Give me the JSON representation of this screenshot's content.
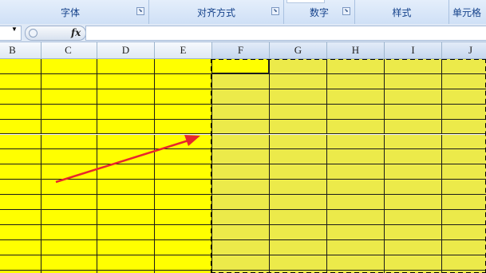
{
  "ribbon": {
    "groups": [
      {
        "label": "字体",
        "launcher": "⬊"
      },
      {
        "label": "对齐方式",
        "launcher": "⬊"
      },
      {
        "label": "数字",
        "launcher": "⬊"
      },
      {
        "label": "样式"
      },
      {
        "label": "单元格"
      }
    ]
  },
  "formula_bar": {
    "name_box_value": "",
    "name_box_arrow": "▼",
    "fx_label": "fx",
    "content": ""
  },
  "columns": [
    "B",
    "C",
    "D",
    "E",
    "F",
    "G",
    "H",
    "I",
    "J"
  ],
  "selected_columns": [
    "F",
    "G",
    "H",
    "I",
    "J"
  ],
  "colors": {
    "unselected_fill": "#ffff00",
    "selected_fill": "#ecea4a",
    "active_cell_fill": "#ffff00",
    "arrow": "#e8262c"
  },
  "icons": {
    "dialog_launcher": "launcher-icon",
    "name_box_dropdown": "dropdown-arrow-icon",
    "function": "fx-icon",
    "annotation_arrow": "red-arrow-icon"
  }
}
